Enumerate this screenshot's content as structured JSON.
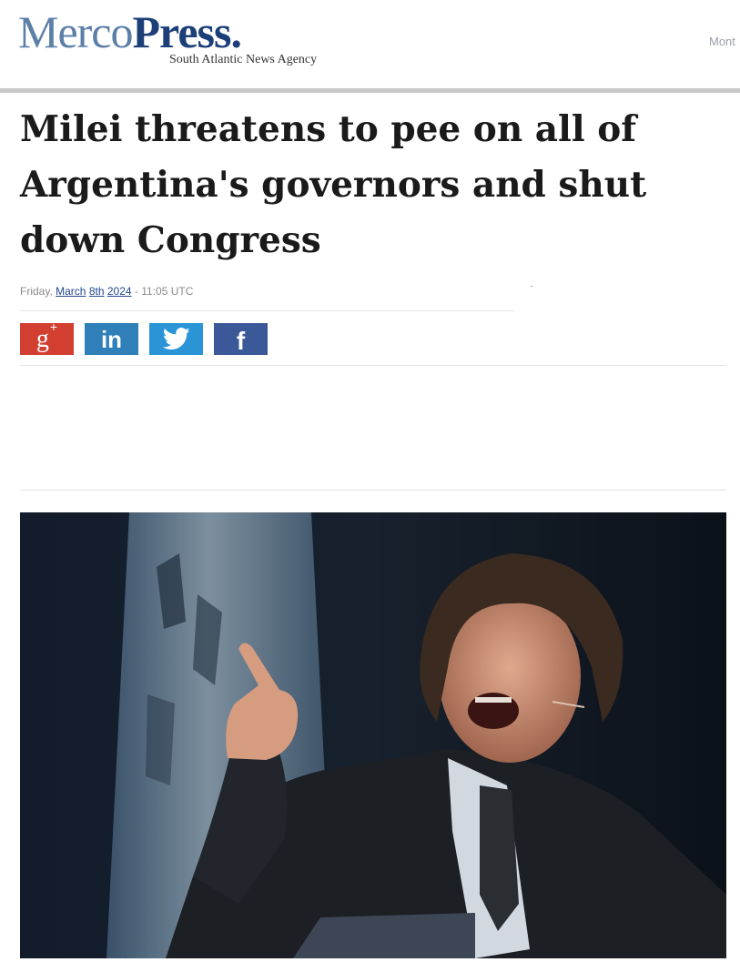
{
  "masthead": {
    "logo_part1": "Merco",
    "logo_part2": "Press.",
    "tagline": "South Atlantic News Agency",
    "top_right_text": "Mont"
  },
  "article": {
    "headline": "Milei threatens to pee on all of Argentina's governors and shut down Congress",
    "dateline": {
      "weekday": "Friday,",
      "date_month": "March",
      "date_day": "8th",
      "date_year": "2024",
      "time": "- 11:05 UTC"
    },
    "share_buttons": [
      {
        "network": "google-plus",
        "icon": "google-plus-icon",
        "color": "#d23f31"
      },
      {
        "network": "linkedin",
        "icon": "linkedin-icon",
        "color": "#2f7fb8"
      },
      {
        "network": "twitter",
        "icon": "twitter-icon",
        "color": "#2a94d7"
      },
      {
        "network": "facebook",
        "icon": "facebook-icon",
        "color": "#3b5998"
      }
    ]
  },
  "colors": {
    "logo_light": "#5c7fa8",
    "logo_dark": "#1d3f79",
    "link": "#24478f"
  }
}
